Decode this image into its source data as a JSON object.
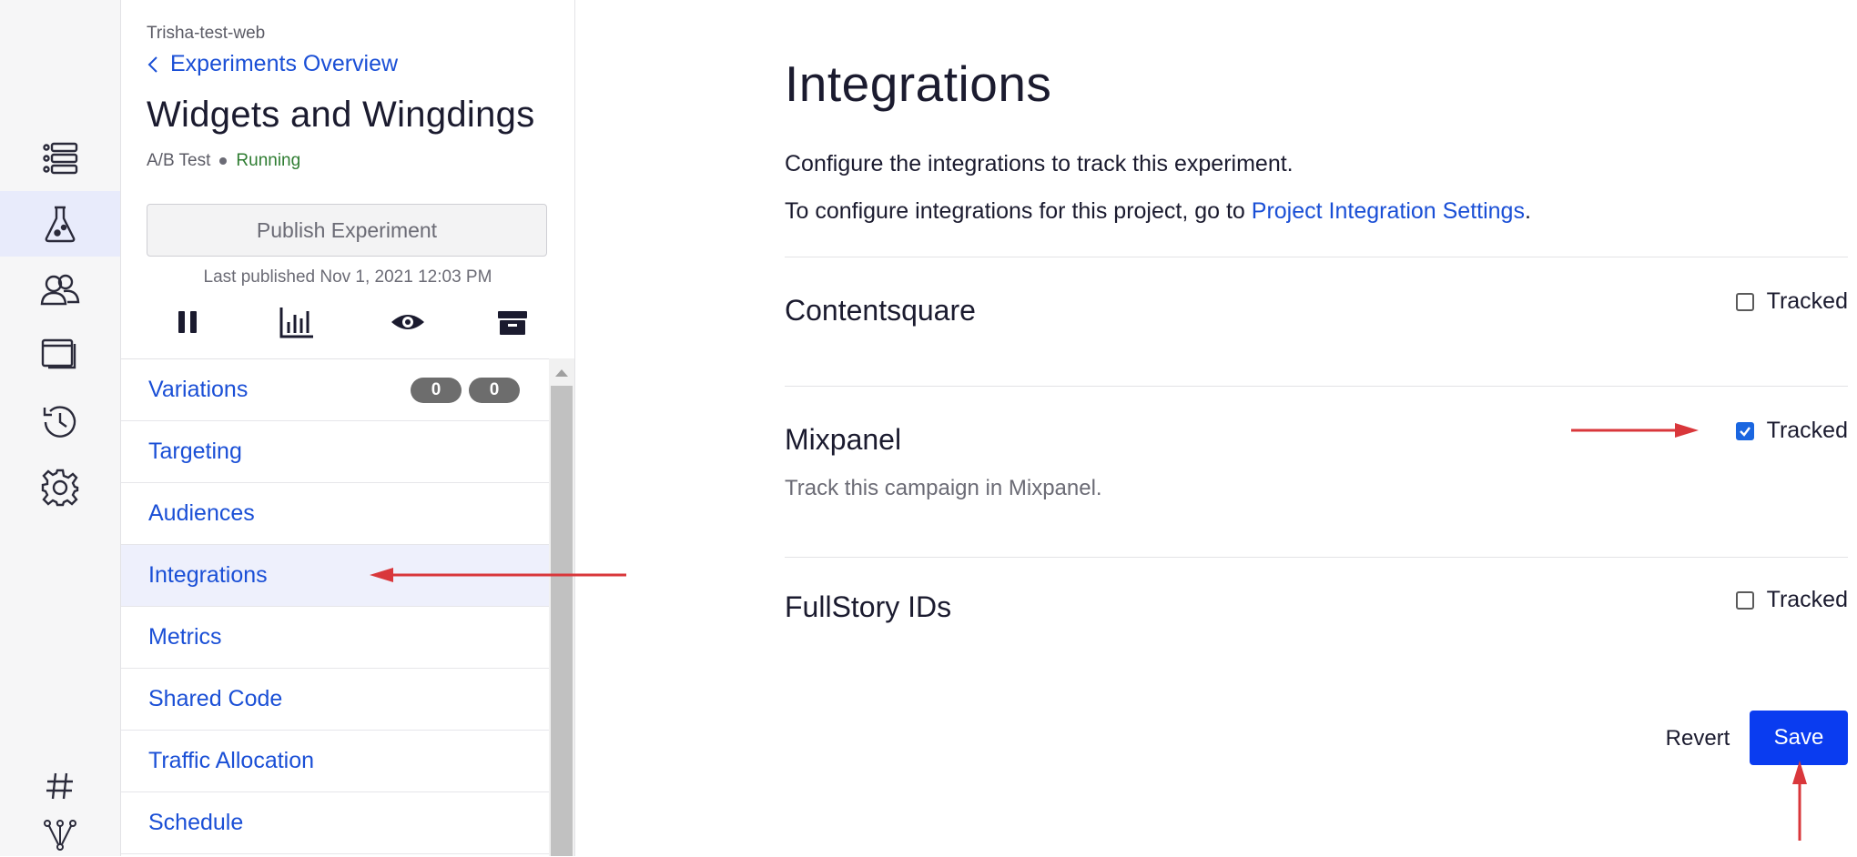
{
  "rail": {
    "icons": [
      "experiments-list-icon",
      "flask-icon",
      "audiences-icon",
      "pages-icon",
      "history-icon",
      "settings-icon",
      "hash-icon",
      "network-icon"
    ],
    "active": "flask-icon"
  },
  "panel": {
    "project_name": "Trisha-test-web",
    "back_link": "Experiments Overview",
    "experiment_title": "Widgets and Wingdings",
    "experiment_type": "A/B Test",
    "status": "Running",
    "publish_button": "Publish Experiment",
    "last_published": "Last published Nov 1, 2021 12:03 PM",
    "toolbar": [
      "pause-icon",
      "results-icon",
      "preview-icon",
      "archive-icon"
    ],
    "nav_items": [
      {
        "label": "Variations",
        "badges": [
          "0",
          "0"
        ]
      },
      {
        "label": "Targeting"
      },
      {
        "label": "Audiences"
      },
      {
        "label": "Integrations",
        "active": true
      },
      {
        "label": "Metrics"
      },
      {
        "label": "Shared Code"
      },
      {
        "label": "Traffic Allocation"
      },
      {
        "label": "Schedule"
      }
    ]
  },
  "main": {
    "title": "Integrations",
    "description": "Configure the integrations to track this experiment.",
    "project_settings_prefix": "To configure integrations for this project, go to ",
    "project_settings_link": "Project Integration Settings",
    "project_settings_suffix": ".",
    "integrations": [
      {
        "name": "Contentsquare",
        "tracked_label": "Tracked",
        "tracked": false,
        "description": ""
      },
      {
        "name": "Mixpanel",
        "tracked_label": "Tracked",
        "tracked": true,
        "description": "Track this campaign in Mixpanel."
      },
      {
        "name": "FullStory IDs",
        "tracked_label": "Tracked",
        "tracked": false,
        "description": ""
      }
    ],
    "revert_button": "Revert",
    "save_button": "Save"
  },
  "colors": {
    "link": "#1a4fd6",
    "primary_button": "#0a3cf0",
    "status_running": "#2f7d32",
    "annotation_arrow": "#d9373b",
    "active_nav_bg": "#eef0fc"
  }
}
